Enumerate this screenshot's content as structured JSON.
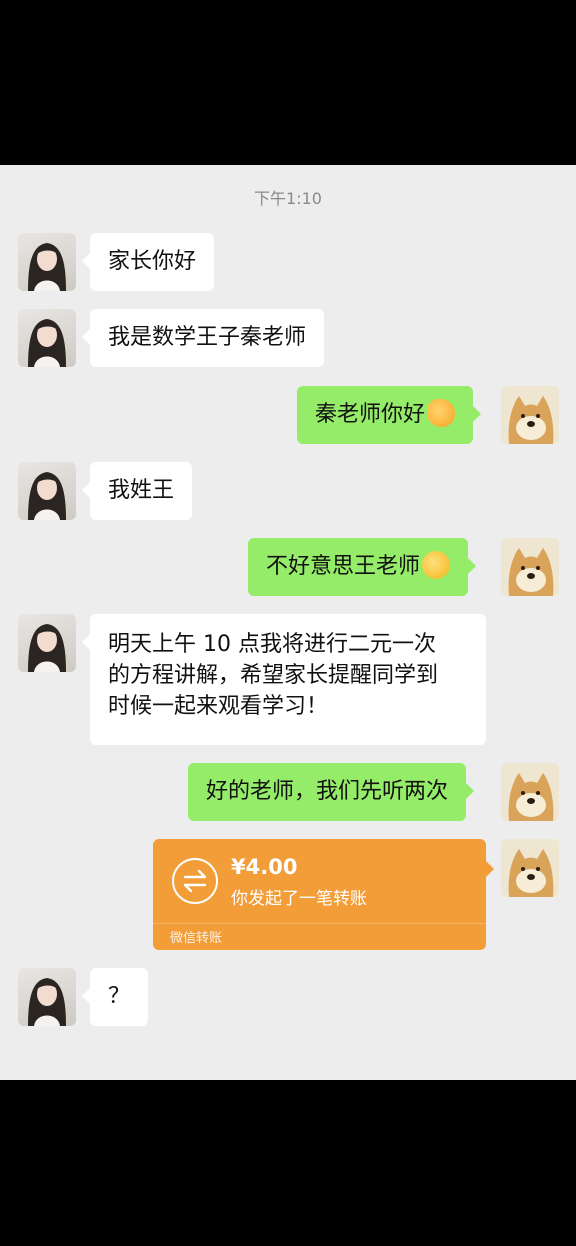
{
  "chat": {
    "timestamp": "下午1:10",
    "messages": [
      {
        "sender": "teacher",
        "text": "家长你好"
      },
      {
        "sender": "teacher",
        "text": "我是数学王子秦老师"
      },
      {
        "sender": "parent",
        "text": "秦老师你好",
        "emoji": "handshake-emoji"
      },
      {
        "sender": "teacher",
        "text": "我姓王"
      },
      {
        "sender": "parent",
        "text": "不好意思王老师",
        "emoji": "crying-laughing-emoji"
      },
      {
        "sender": "teacher",
        "lines": [
          "明天上午 10 点我将进行二元一次",
          "的方程讲解，希望家长提醒同学到",
          "时候一起来观看学习！"
        ]
      },
      {
        "sender": "parent",
        "text": "好的老师，我们先听两次"
      },
      {
        "sender": "parent",
        "type": "transfer",
        "amount": "¥4.00",
        "description": "你发起了一笔转账",
        "footer": "微信转账"
      },
      {
        "sender": "teacher",
        "text": "？"
      }
    ]
  },
  "colors": {
    "chat_background": "#ededed",
    "incoming_bubble": "#ffffff",
    "outgoing_bubble": "#95ec69",
    "transfer_card": "#f29d38",
    "timestamp_text": "#8a8a8a"
  },
  "icons": {
    "teacher_avatar": "teacher-avatar",
    "parent_avatar": "doge-avatar",
    "transfer": "transfer-arrows-icon"
  }
}
